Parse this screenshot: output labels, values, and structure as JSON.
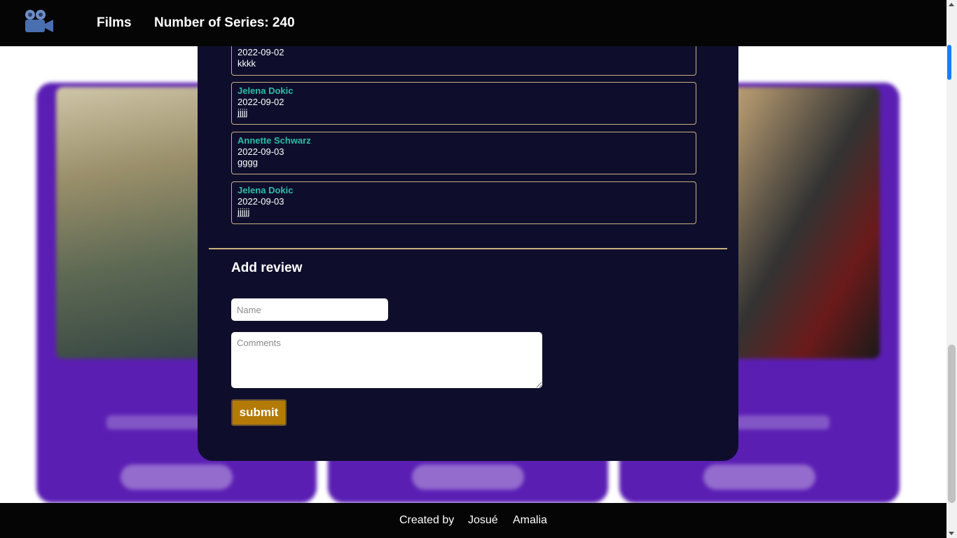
{
  "navbar": {
    "logo_icon": "film-camera-icon",
    "films_label": "Films",
    "series_count": "Number of Series: 240"
  },
  "reviews": [
    {
      "author": "",
      "date": "2022-09-02",
      "comment": "kkkk"
    },
    {
      "author": "Jelena Dokic",
      "date": "2022-09-02",
      "comment": "jjjjj"
    },
    {
      "author": "Annette Schwarz",
      "date": "2022-09-03",
      "comment": "gggg"
    },
    {
      "author": "Jelena Dokic",
      "date": "2022-09-03",
      "comment": "jjjjjj"
    }
  ],
  "add_review": {
    "title": "Add review",
    "name_placeholder": "Name",
    "comments_placeholder": "Comments",
    "submit_label": "submit"
  },
  "footer": {
    "created_by": "Created by",
    "author1": "Josué",
    "author2": "Amalia"
  },
  "colors": {
    "navbar": "#050505",
    "card_bg": "#5a1eb3",
    "modal_bg": "#0e0e2c",
    "author_accent": "#2bbfa8",
    "border_gold": "#c9b07e",
    "submit_bg": "#b47a08"
  }
}
